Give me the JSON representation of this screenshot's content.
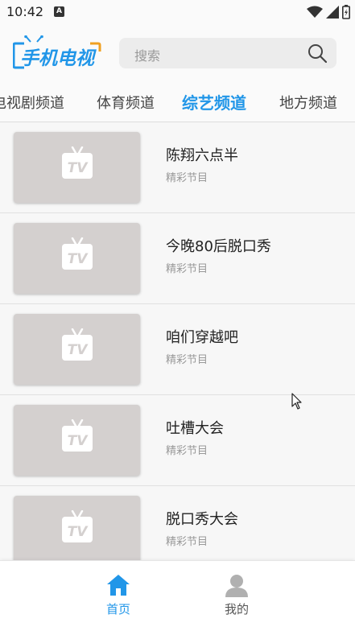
{
  "status_bar": {
    "time": "10:42",
    "notification_icon": "A"
  },
  "header": {
    "logo_text": "手机电视",
    "search": {
      "placeholder": "搜索"
    }
  },
  "tabs": [
    {
      "label": "电视剧频道",
      "active": false
    },
    {
      "label": "体育频道",
      "active": false
    },
    {
      "label": "综艺频道",
      "active": true
    },
    {
      "label": "地方频道",
      "active": false
    }
  ],
  "programs": [
    {
      "title": "陈翔六点半",
      "subtitle": "精彩节目"
    },
    {
      "title": "今晚80后脱口秀",
      "subtitle": "精彩节目"
    },
    {
      "title": "咱们穿越吧",
      "subtitle": "精彩节目"
    },
    {
      "title": "吐槽大会",
      "subtitle": "精彩节目"
    },
    {
      "title": "脱口秀大会",
      "subtitle": "精彩节目"
    }
  ],
  "thumb_label": "TV",
  "bottom_nav": [
    {
      "label": "首页",
      "icon": "home-icon",
      "active": true
    },
    {
      "label": "我的",
      "icon": "person-icon",
      "active": false
    }
  ],
  "colors": {
    "accent": "#2196e8",
    "thumb": "#d4d0cf"
  }
}
